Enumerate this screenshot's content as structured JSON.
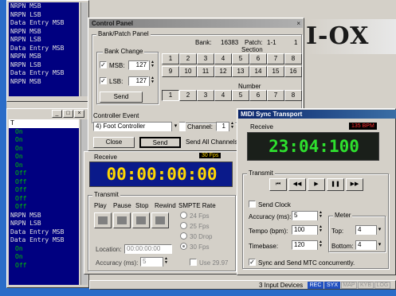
{
  "left_log_top": {
    "lines": [
      "NRPN MSB",
      "NRPN LSB",
      "Data Entry MSB",
      "NRPN MSB",
      "NRPN LSB",
      "Data Entry MSB",
      "NRPN MSB",
      "NRPN LSB",
      "Data Entry MSB",
      "NRPN MSB"
    ]
  },
  "left_log_bottom": {
    "header": "T",
    "lines": [
      "On",
      "On",
      "On",
      "On",
      "On",
      "Off",
      "Off",
      "Off",
      "Off",
      "Off",
      "NRPN MSB",
      "NRPN LSB",
      "Data Entry MSB",
      "Data Entry MSB",
      "On",
      "On",
      "Off"
    ]
  },
  "logo_text": "I-OX",
  "control_panel": {
    "title": "Control Panel",
    "bank_patch_group": "Bank/Patch Panel",
    "bank_label": "Bank:",
    "bank_value": "16383",
    "patch_label": "Patch:",
    "patch_value": "1-1",
    "patch_extra": "1",
    "bank_change_group": "Bank Change",
    "msb_label": "MSB:",
    "msb_value": "127",
    "lsb_label": "LSB:",
    "lsb_value": "127",
    "send_label": "Send",
    "section_label": "Section",
    "section_row1": [
      "1",
      "2",
      "3",
      "4",
      "5",
      "6",
      "7",
      "8"
    ],
    "section_row2": [
      "9",
      "10",
      "11",
      "12",
      "13",
      "14",
      "15",
      "16"
    ],
    "number_label": "Number",
    "number_row": [
      "1",
      "2",
      "3",
      "4",
      "5",
      "6",
      "7",
      "8"
    ],
    "controller_event_label": "Controller Event",
    "controller_value": "4)  Foot Controller",
    "channel_label": "Channel:",
    "channel_value": "1",
    "close_label": "Close",
    "send2_label": "Send",
    "send_all_label": "Send All Channels"
  },
  "mtc_window": {
    "receive_label": "Receive",
    "fps_badge": "30 Fps",
    "timecode": "00:00:00:00",
    "transmit_label": "Transmit",
    "transport_labels": [
      "Play",
      "Pause",
      "Stop",
      "Rewind"
    ],
    "smpte_label": "SMPTE Rate",
    "rates": [
      "24 Fps",
      "25 Fps",
      "30 Drop",
      "30 Fps"
    ],
    "use_2997": "Use 29.97",
    "location_label": "Location:",
    "location_value": "00:00:00:00",
    "accuracy_label": "Accuracy (ms):",
    "accuracy_value": "5"
  },
  "midi_sync": {
    "title": "MIDI Sync Transport",
    "receive_label": "Receive",
    "bpm_badge": "135 BPM",
    "time_display": "23:04:100",
    "transmit_label": "Transmit",
    "transport_icons": [
      "⏮",
      "◀◀",
      "▶",
      "❚❚",
      "▶▶"
    ],
    "send_clock_label": "Send Clock",
    "accuracy_label": "Accuracy (ms):",
    "accuracy_value": "5",
    "tempo_label": "Tempo (bpm):",
    "tempo_value": "100",
    "timebase_label": "Timebase:",
    "timebase_value": "120",
    "meter_label": "Meter",
    "top_label": "Top:",
    "top_value": "4",
    "bottom_label": "Bottom:",
    "bottom_value": "4",
    "sync_mtc_label": "Sync and Send MTC concurrently."
  },
  "status_bar": {
    "devices": "3 Input Devices",
    "badges": [
      "REC",
      "SYX",
      "MAP",
      "KYB",
      "LOG"
    ]
  },
  "colors": {
    "log_bg": "#000080",
    "log_fg": "#e0e0e0",
    "log_green": "#00c000",
    "lcd_bg": "#1a1f1a",
    "lcd_green": "#2ee02e",
    "mtc_blue": "#0a1a8a",
    "mtc_yellow": "#ffd700",
    "desktop_blue": "#2a6cc8"
  }
}
